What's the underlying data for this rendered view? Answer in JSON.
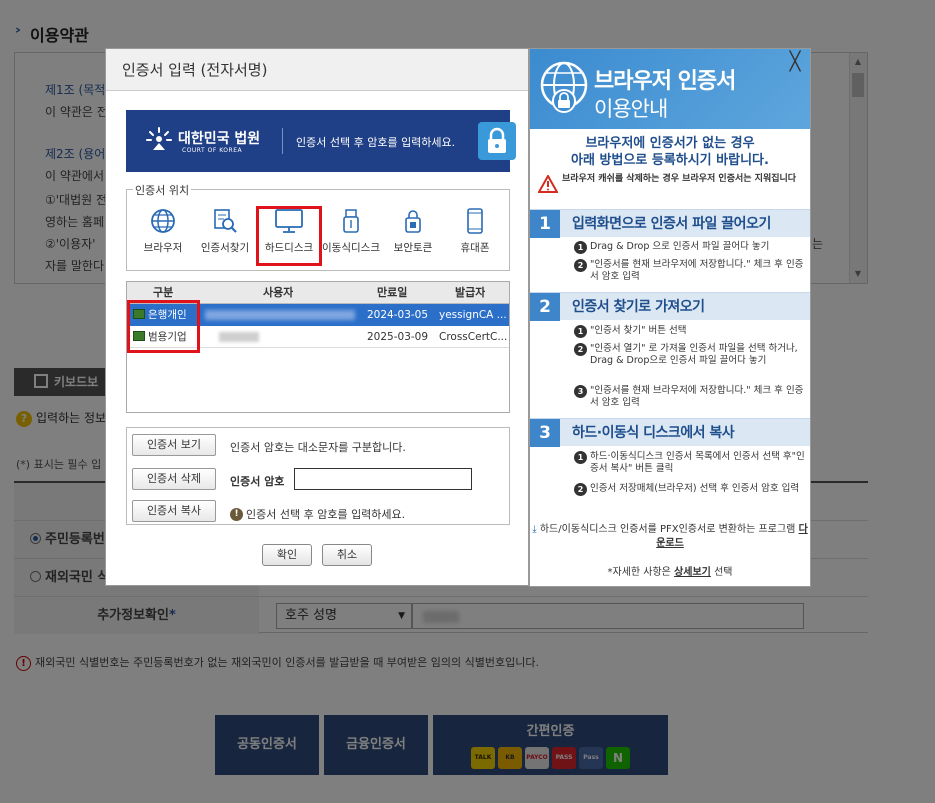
{
  "background": {
    "section_title": "이용약관",
    "terms": [
      {
        "label": "제1조 (목적)",
        "text": "이 약관은 전"
      },
      {
        "label": "제2조 (용어",
        "text": "이 약관에서"
      }
    ],
    "terms_lines": [
      "①'대법원 전",
      "영하는 홈페",
      "②'이용자'",
      "자를 말한다"
    ],
    "terms_fragment": "는",
    "keyboard_label": "키보드보",
    "question_text": "입력하는 정보",
    "required_text": "(*) 표시는 필수 입",
    "form": {
      "name_label": "성명",
      "radio1_label": "주민등록번",
      "radio2_label": "재외국민 식",
      "extra_label": "추가정보확인",
      "select_value": "호주 성명"
    },
    "note": "재외국민 식별번호는 주민등록번호가 없는 재외국민이 인증서를 발급받을 때 부여받은 임의의 식별번호입니다.",
    "buttons": {
      "joint": "공동인증서",
      "financial": "금융인증서",
      "simple": "간편인증"
    },
    "pay_icons": [
      "TALK",
      "KB",
      "PAYCO",
      "PASS",
      "Pass",
      "N"
    ]
  },
  "dialog": {
    "title": "인증서 입력 (전자서명)",
    "banner": {
      "court_ko": "대한민국 법원",
      "court_en": "COURT OF KOREA",
      "message": "인증서 선택 후 암호를 입력하세요."
    },
    "location_legend": "인증서 위치",
    "locations": [
      "브라우저",
      "인증서찾기",
      "하드디스크",
      "이동식디스크",
      "보안토큰",
      "휴대폰"
    ],
    "table": {
      "headers": [
        "구분",
        "사용자",
        "만료일",
        "발급자"
      ],
      "rows": [
        {
          "type": "은행개인",
          "expiry": "2024-03-05",
          "issuer": "yessignCA ..."
        },
        {
          "type": "범용기업",
          "expiry": "2025-03-09",
          "issuer": "CrossCertC..."
        }
      ]
    },
    "actions": {
      "view": "인증서 보기",
      "delete": "인증서 삭제",
      "copy": "인증서 복사"
    },
    "case_note": "인증서 암호는 대소문자를 구분합니다.",
    "password_label": "인증서 암호",
    "password_value": "",
    "warning": "인증서 선택 후 암호를 입력하세요.",
    "ok": "확인",
    "cancel": "취소"
  },
  "guide": {
    "title1": "브라우저 인증서",
    "title2": "이용안내",
    "close": "╳",
    "intro1": "브라우저에 인증서가 없는 경우",
    "intro2": "아래 방법으로 등록하시기 바랍니다.",
    "warning": "브라우저 캐쉬를 삭제하는 경우 브라우저 인증서는 지워집니다",
    "sections": [
      {
        "num": "1",
        "title": "입력화면으로 인증서 파일 끌어오기",
        "steps": [
          "Drag & Drop 으로 인증서 파일 끌어다 놓기",
          "\"인증서를 현재 브라우저에 저장합니다.\" 체크 후 인증서 암호 입력"
        ]
      },
      {
        "num": "2",
        "title": "인증서 찾기로 가져오기",
        "steps": [
          "\"인증서 찾기\" 버튼 선택",
          "\"인증서 열기\" 로 가져올 인증서 파일을 선택 하거나, Drag & Drop으로 인증서 파일 끌어다 놓기",
          "\"인증서를 현재 브라우저에 저장합니다.\" 체크 후 인증서 암호 입력"
        ]
      },
      {
        "num": "3",
        "title": "하드·이동식 디스크에서 복사",
        "steps": [
          "하드·이동식디스크 인증서 목록에서 인증서 선택 후\"인증서 복사\" 버튼 클릭",
          "인증서 저장매체(브라우저) 선택 후 인증서 암호 입력"
        ]
      }
    ],
    "download_text": "하드/이동식디스크 인증서를 PFX인증서로 변환하는 프로그램",
    "download_link": "다운로드",
    "more_prefix": "*자세한 사항은",
    "more_link": "상세보기",
    "more_suffix": "선택"
  },
  "colors": {
    "accent": "#2a5aa0",
    "highlight": "#e0131b",
    "selected_row": "#2b6fc9",
    "banner": "#1f3f86",
    "guide_header": "#3b8bd0"
  }
}
